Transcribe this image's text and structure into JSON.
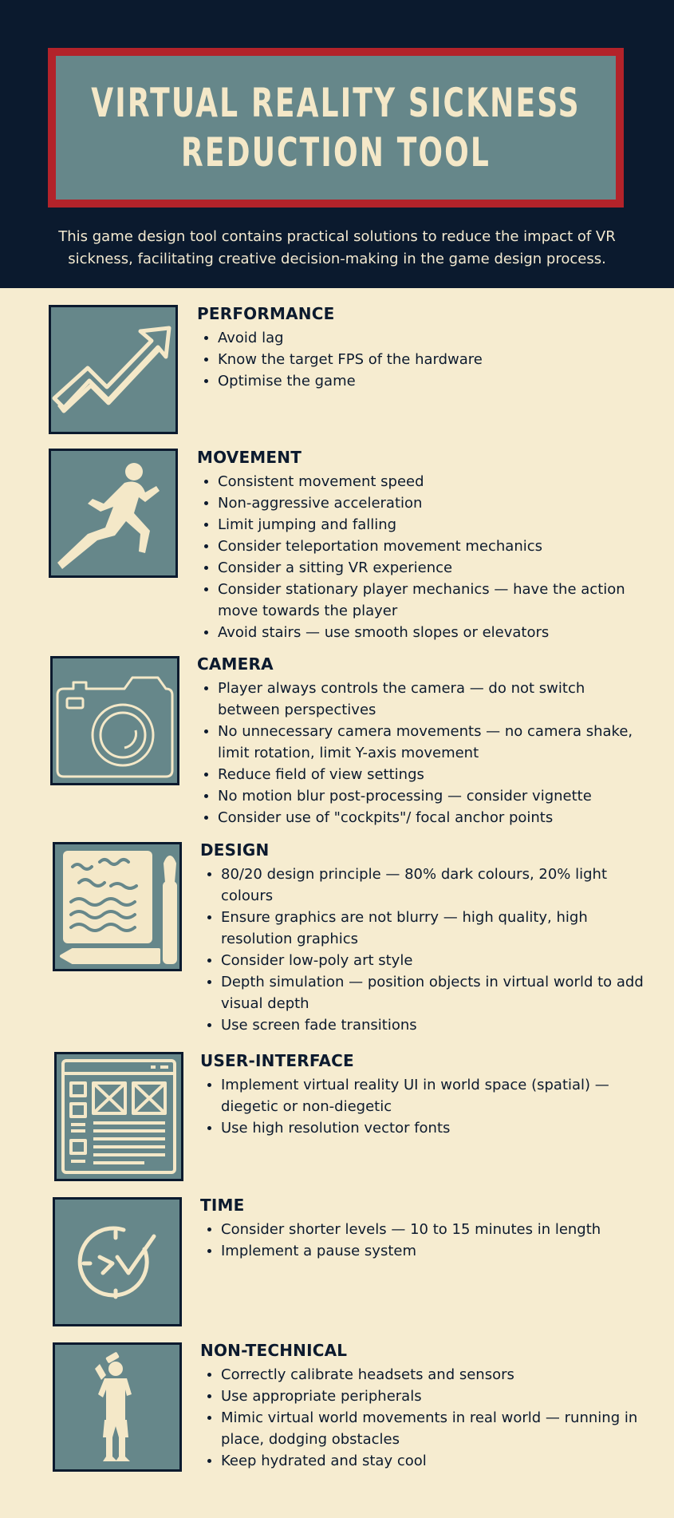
{
  "header": {
    "title_line1": "VIRTUAL REALITY SICKNESS",
    "title_line2": "REDUCTION TOOL",
    "subtitle": "This game design tool contains practical solutions to reduce the impact of VR sickness, facilitating creative decision-making in the game design process."
  },
  "colors": {
    "header_bg": "#0b1a2e",
    "title_border": "#b3232a",
    "icon_bg": "#66878a",
    "page_bg": "#f6ecd0",
    "icon_fg": "#f4e8c8"
  },
  "sections": [
    {
      "heading": "PERFORMANCE",
      "icon": "trend-up-arrow-icon",
      "items": [
        "Avoid lag",
        "Know the target FPS of the hardware",
        "Optimise the game"
      ]
    },
    {
      "heading": "MOVEMENT",
      "icon": "running-person-icon",
      "items": [
        "Consistent movement speed",
        "Non-aggressive acceleration",
        "Limit jumping and falling",
        "Consider teleportation movement mechanics",
        "Consider a sitting VR experience",
        "Consider stationary player mechanics — have the action move towards the player",
        "Avoid stairs — use smooth slopes or elevators"
      ]
    },
    {
      "heading": "CAMERA",
      "icon": "camera-icon",
      "items": [
        "Player always controls the camera — do not switch between perspectives",
        "No unnecessary camera movements — no camera shake, limit rotation, limit Y-axis movement",
        "Reduce field of view settings",
        "No motion blur post-processing — consider vignette",
        "Consider use of \"cockpits\"/ focal anchor points"
      ]
    },
    {
      "heading": "DESIGN",
      "icon": "canvas-brush-icon",
      "items": [
        "80/20 design principle — 80% dark colours, 20% light colours",
        "Ensure graphics are not blurry — high quality, high resolution graphics",
        "Consider low-poly art style",
        "Depth simulation — position objects in virtual world to add visual depth",
        "Use screen fade transitions"
      ]
    },
    {
      "heading": "USER-INTERFACE",
      "icon": "web-layout-icon",
      "items": [
        "Implement virtual reality UI in world space (spatial) — diegetic or non-diegetic",
        "Use high resolution vector fonts"
      ]
    },
    {
      "heading": "TIME",
      "icon": "clock-check-icon",
      "items": [
        "Consider shorter levels — 10 to 15 minutes in length",
        "Implement a pause system"
      ]
    },
    {
      "heading": "NON-TECHNICAL",
      "icon": "drinking-person-icon",
      "items": [
        "Correctly calibrate headsets and sensors",
        "Use appropriate peripherals",
        "Mimic virtual world movements in real world — running in place, dodging obstacles",
        "Keep hydrated and stay cool"
      ]
    }
  ]
}
